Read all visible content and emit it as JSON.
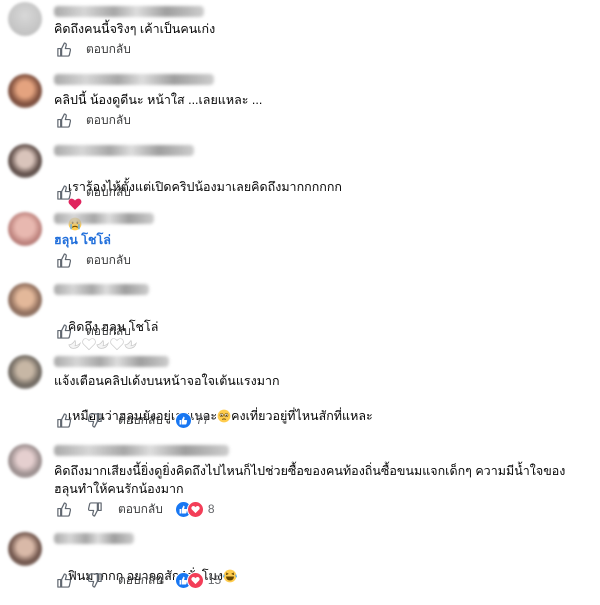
{
  "comments": [
    {
      "text": "คิดถึงคนนี้จริงๆ เค้าเป็นคนเก่ง",
      "reply": "ตอบกลับ"
    },
    {
      "text": "คลิปนี้ น้องดูดีนะ หน้าใส ...เลยแหละ ...",
      "reply": "ตอบกลับ"
    },
    {
      "text": "เราร้องไห้ตั้งแต่เปิดคริปน้องมาเลยคิดถึงมากกกกกก",
      "emoji": [
        "red-heart",
        "crying-face"
      ],
      "reply": "ตอบกลับ"
    },
    {
      "text": "ฮลุน โชโล่",
      "reply": "ตอบกลับ"
    },
    {
      "text": "คิดถึง ฮลุน โชโล่",
      "emoji": [
        "white-dove",
        "white-heart",
        "white-dove",
        "white-heart",
        "white-dove"
      ],
      "reply": "ตอบกลับ"
    },
    {
      "line1": "แจ้งเตือนคลิปเด้งบนหน้าจอใจเต้นแรงมาก",
      "line2a": "เหมือนว่าฮลุนยังอยู่เลยเนอะ",
      "line2b": "คงเที่ยวอยู่ที่ไหนสักที่แหละ",
      "emoji": [
        "teary-face"
      ],
      "reply": "ตอบกลับ",
      "reaction_count": "77"
    },
    {
      "line1": "คิดถึงมากเสียงนี้ยิ่งดูยิ่งคิดถึงไปไหนก็ไปช่วยซื้อของคนท้องถิ่นซื้อขนมแจกเด็กๆ ความมีน้ำใจของ",
      "line2": "ฮลุนทำให้คนรักน้องมาก",
      "reply": "ตอบกลับ",
      "reaction_count": "8"
    },
    {
      "text": "ฟินมากกก อยากดูสัก4ชั่วโมง",
      "emoji": [
        "laughing-face"
      ],
      "reply": "ตอบกลับ",
      "reaction_count": "15"
    }
  ],
  "colors": {
    "like_blue": "#1877f2",
    "love_red": "#f33e58",
    "link_blue": "#216fdb",
    "meta_gray": "#65676b"
  }
}
